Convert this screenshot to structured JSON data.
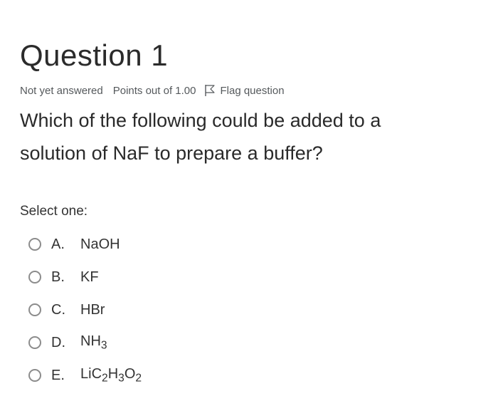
{
  "question": {
    "heading": "Question 1",
    "state": "Not yet answered",
    "grade": "Points out of 1.00",
    "flag_label": "Flag question",
    "text": "Which of the following could be added to a solution of NaF to prepare a buffer?",
    "prompt": "Select one:"
  },
  "answers": [
    {
      "letter": "A.",
      "text": "NaOH",
      "selected": false
    },
    {
      "letter": "B.",
      "text": "KF",
      "selected": false
    },
    {
      "letter": "C.",
      "text": "HBr",
      "selected": false
    },
    {
      "letter": "D.",
      "text": "NH3",
      "selected": false
    },
    {
      "letter": "E.",
      "text": "LiC2H3O2",
      "selected": false
    }
  ],
  "icons": {
    "flag": "flag-icon"
  }
}
